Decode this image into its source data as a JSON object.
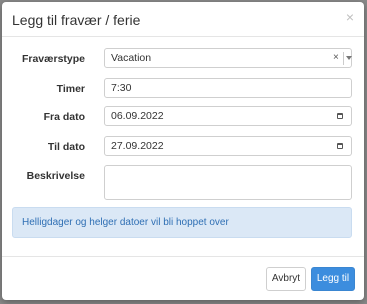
{
  "dialog": {
    "title": "Legg til fravær / ferie",
    "close_icon": "close-icon"
  },
  "form": {
    "absence_type": {
      "label": "Fraværstype",
      "value": "Vacation"
    },
    "hours": {
      "label": "Timer",
      "value": "7:30"
    },
    "from_date": {
      "label": "Fra dato",
      "value": "06.09.2022"
    },
    "to_date": {
      "label": "Til dato",
      "value": "27.09.2022"
    },
    "description": {
      "label": "Beskrivelse",
      "value": ""
    }
  },
  "info": {
    "text": "Helligdager og helger datoer vil bli hoppet over"
  },
  "footer": {
    "cancel_label": "Avbryt",
    "add_label": "Legg til"
  },
  "colors": {
    "primary": "#3c8dde",
    "info_bg": "#dbe8f6",
    "info_text": "#2f6fb4"
  }
}
